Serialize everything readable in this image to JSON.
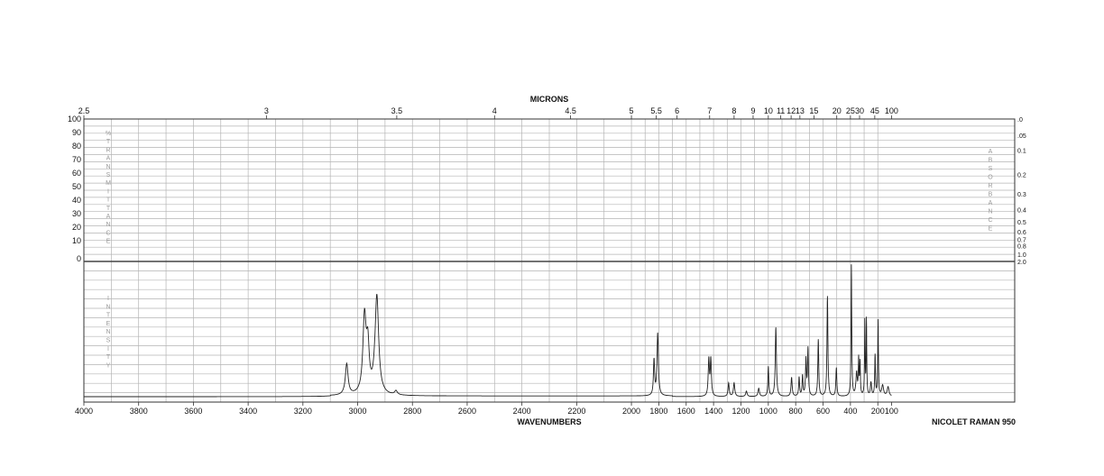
{
  "chart_data": {
    "type": "line",
    "instrument": "NICOLET RAMAN 950",
    "x_axis": {
      "title": "WAVENUMBERS",
      "range": [
        4000,
        100
      ],
      "ticks": [
        "4000",
        "3800",
        "3600",
        "3400",
        "3200",
        "3000",
        "2800",
        "2600",
        "2400",
        "2200",
        "2000",
        "1800",
        "1600",
        "1400",
        "1200",
        "1000",
        "800",
        "600",
        "400",
        "200",
        "100"
      ]
    },
    "top_axis": {
      "title": "MICRONS",
      "ticks": [
        "2.5",
        "3",
        "3.5",
        "4",
        "4.5",
        "5",
        "5.5",
        "6",
        "7",
        "8",
        "9",
        "10",
        "11",
        "12",
        "13",
        "15",
        "20",
        "25",
        "30",
        "45",
        "100"
      ]
    },
    "upper_panel": {
      "left_label_letters": [
        "%",
        "T",
        "R",
        "A",
        "N",
        "S",
        "M",
        "I",
        "T",
        "T",
        "A",
        "N",
        "C",
        "E"
      ],
      "left_ticks": [
        "100",
        "90",
        "80",
        "70",
        "60",
        "50",
        "40",
        "30",
        "20",
        "10",
        "0"
      ],
      "right_label_letters": [
        "A",
        "B",
        "S",
        "O",
        "R",
        "B",
        "A",
        "N",
        "C",
        "E"
      ],
      "right_ticks": [
        ".0",
        ".05",
        "0.1",
        "0.2",
        "0.3",
        "0.4",
        "0.5",
        "0.6",
        "0.7",
        "0.8",
        "1.0",
        "2.0"
      ]
    },
    "lower_panel": {
      "left_label_letters": [
        "I",
        "N",
        "T",
        "E",
        "N",
        "S",
        "I",
        "T",
        "Y"
      ]
    },
    "grid": true,
    "series": [
      {
        "baseline": 0.02,
        "peaks": [
          {
            "x": 3040,
            "y": 0.23,
            "w": 6
          },
          {
            "x": 2975,
            "y": 0.56,
            "w": 7
          },
          {
            "x": 2963,
            "y": 0.32,
            "w": 6
          },
          {
            "x": 2930,
            "y": 0.73,
            "w": 8
          },
          {
            "x": 2860,
            "y": 0.03,
            "w": 6
          },
          {
            "x": 1835,
            "y": 0.26,
            "w": 5
          },
          {
            "x": 1808,
            "y": 0.46,
            "w": 6
          },
          {
            "x": 1435,
            "y": 0.27,
            "w": 5
          },
          {
            "x": 1420,
            "y": 0.27,
            "w": 5
          },
          {
            "x": 1290,
            "y": 0.1,
            "w": 5
          },
          {
            "x": 1250,
            "y": 0.1,
            "w": 6
          },
          {
            "x": 1160,
            "y": 0.04,
            "w": 6
          },
          {
            "x": 1070,
            "y": 0.06,
            "w": 6
          },
          {
            "x": 1000,
            "y": 0.22,
            "w": 4
          },
          {
            "x": 945,
            "y": 0.51,
            "w": 5
          },
          {
            "x": 830,
            "y": 0.14,
            "w": 5
          },
          {
            "x": 775,
            "y": 0.14,
            "w": 4
          },
          {
            "x": 750,
            "y": 0.15,
            "w": 4
          },
          {
            "x": 725,
            "y": 0.27,
            "w": 4
          },
          {
            "x": 710,
            "y": 0.35,
            "w": 4
          },
          {
            "x": 635,
            "y": 0.42,
            "w": 4
          },
          {
            "x": 568,
            "y": 0.74,
            "w": 4
          },
          {
            "x": 503,
            "y": 0.21,
            "w": 4
          },
          {
            "x": 393,
            "y": 0.97,
            "w": 3
          },
          {
            "x": 355,
            "y": 0.17,
            "w": 6
          },
          {
            "x": 340,
            "y": 0.26,
            "w": 3
          },
          {
            "x": 330,
            "y": 0.24,
            "w": 3
          },
          {
            "x": 295,
            "y": 0.55,
            "w": 2.5
          },
          {
            "x": 283,
            "y": 0.56,
            "w": 2.5
          },
          {
            "x": 250,
            "y": 0.1,
            "w": 5
          },
          {
            "x": 220,
            "y": 0.3,
            "w": 3
          },
          {
            "x": 198,
            "y": 0.56,
            "w": 3
          },
          {
            "x": 165,
            "y": 0.08,
            "w": 8
          },
          {
            "x": 125,
            "y": 0.07,
            "w": 8
          }
        ]
      }
    ]
  }
}
